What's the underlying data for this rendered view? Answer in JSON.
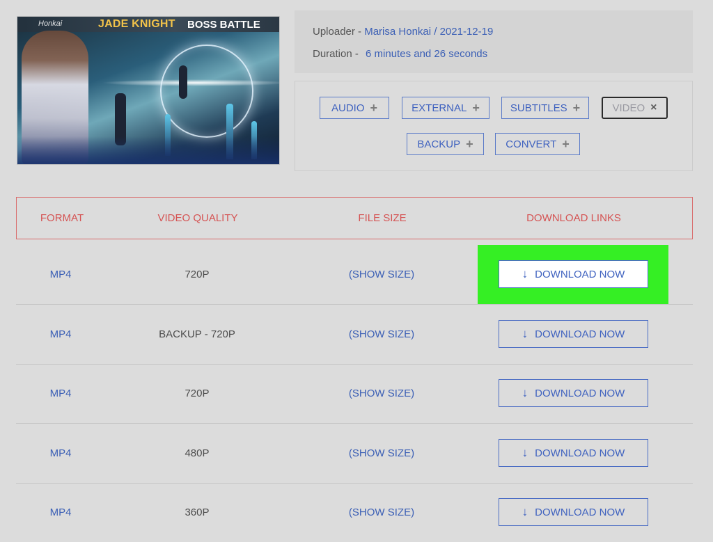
{
  "thumbnail": {
    "logo_text": "Honkai",
    "title_part1": "JADE KNIGHT",
    "title_part2": "BOSS BATTLE"
  },
  "info": {
    "uploader_label": "Uploader -",
    "uploader_value": "Marisa Honkai / 2021-12-19",
    "duration_label": "Duration -",
    "duration_value": "6 minutes and 26 seconds"
  },
  "tags": [
    {
      "label": "AUDIO",
      "icon": "+"
    },
    {
      "label": "EXTERNAL",
      "icon": "+"
    },
    {
      "label": "SUBTITLES",
      "icon": "+"
    },
    {
      "label": "VIDEO",
      "icon": "×"
    },
    {
      "label": "BACKUP",
      "icon": "+"
    },
    {
      "label": "CONVERT",
      "icon": "+"
    }
  ],
  "table": {
    "headers": [
      "FORMAT",
      "VIDEO QUALITY",
      "FILE SIZE",
      "DOWNLOAD LINKS"
    ],
    "rows": [
      {
        "format": "MP4",
        "quality": "720P",
        "size": "(SHOW SIZE)",
        "download": "DOWNLOAD NOW"
      },
      {
        "format": "MP4",
        "quality": "BACKUP - 720P",
        "size": "(SHOW SIZE)",
        "download": "DOWNLOAD NOW"
      },
      {
        "format": "MP4",
        "quality": "720P",
        "size": "(SHOW SIZE)",
        "download": "DOWNLOAD NOW"
      },
      {
        "format": "MP4",
        "quality": "480P",
        "size": "(SHOW SIZE)",
        "download": "DOWNLOAD NOW"
      },
      {
        "format": "MP4",
        "quality": "360P",
        "size": "(SHOW SIZE)",
        "download": "DOWNLOAD NOW"
      }
    ],
    "download_icon": "↓"
  },
  "colors": {
    "highlight": "#35ef24",
    "link": "#3b5fb5",
    "header_red": "#d55353"
  }
}
